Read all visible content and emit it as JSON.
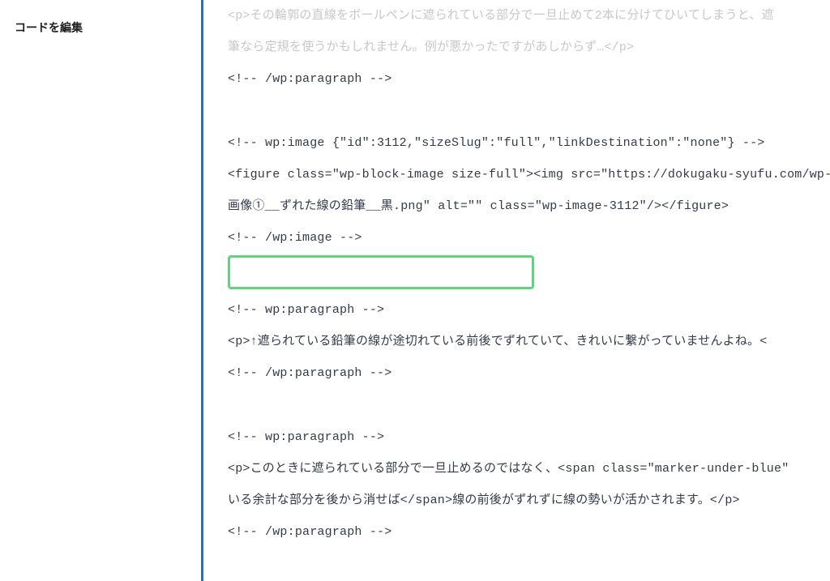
{
  "sidebar": {
    "title": "コードを編集"
  },
  "code": {
    "line1": "<p>その輪郭の直線をボールペンに遮られている部分で一旦止めて2本に分けてひいてしまうと、遮",
    "line2": "筆なら定規を使うかもしれません。例が悪かったですがあしからず…</p>",
    "line3": "<!-- /wp:paragraph -->",
    "line4": "<!-- wp:image {\"id\":3112,\"sizeSlug\":\"full\",\"linkDestination\":\"none\"} -->",
    "line5": "<figure class=\"wp-block-image size-full\"><img src=\"https://dokugaku-syufu.com/wp-",
    "line6": "画像①__ずれた線の鉛筆__黒.png\" alt=\"\" class=\"wp-image-3112\"/></figure>",
    "line7": "<!-- /wp:image -->",
    "line8": "<!-- wp:paragraph -->",
    "line9": "<p>↑遮られている鉛筆の線が途切れている前後でずれていて、きれいに繋がっていませんよね。<",
    "line10": "<!-- /wp:paragraph -->",
    "line11": "<!-- wp:paragraph -->",
    "line12": "<p>このときに遮られている部分で一旦止めるのではなく、<span class=\"marker-under-blue\"",
    "line13": "いる余計な部分を後から消せば</span>線の前後がずれずに線の勢いが活かされます。</p>",
    "line14": "<!-- /wp:paragraph -->"
  }
}
